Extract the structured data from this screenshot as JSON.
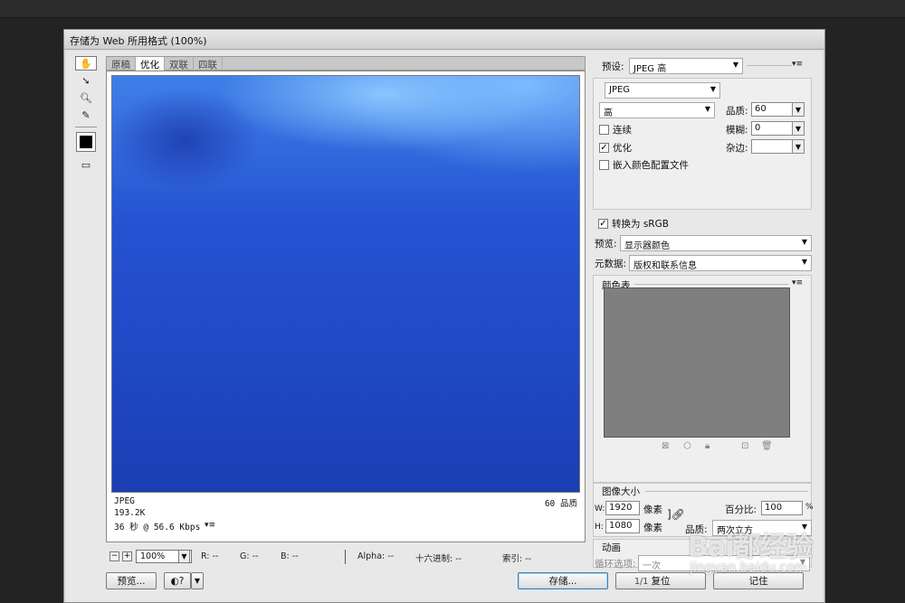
{
  "window": {
    "title": "存储为 Web 所用格式 (100%)"
  },
  "toolbox": {
    "tools": [
      "hand-tool",
      "slice-select-tool",
      "zoom-tool",
      "eyedropper-tool"
    ],
    "swatch_color": "#000000"
  },
  "tabs": [
    "原稿",
    "优化",
    "双联",
    "四联"
  ],
  "active_tab": "优化",
  "preview": {
    "format": "JPEG",
    "size": "193.2K",
    "time": "36 秒 @ 56.6 Kbps",
    "quality_label": "60 品质"
  },
  "status": {
    "zoom": "100%",
    "r": "R: --",
    "g": "G: --",
    "b": "B: --",
    "alpha": "Alpha: --",
    "hex": "十六进制: --",
    "index": "索引: --"
  },
  "buttons": {
    "preview": "预览...",
    "save": "存储...",
    "reset": "复位",
    "remember": "记住"
  },
  "settings": {
    "preset_label": "预设:",
    "preset_value": "JPEG 高",
    "format_value": "JPEG",
    "quality_preset": "高",
    "quality_label": "品质:",
    "quality_value": "60",
    "progressive_label": "连续",
    "blur_label": "模糊:",
    "blur_value": "0",
    "optimized_label": "优化",
    "matte_label": "杂边:",
    "embed_profile_label": "嵌入颜色配置文件",
    "convert_srgb_label": "转换为 sRGB",
    "preview_label": "预览:",
    "preview_value": "显示器颜色",
    "metadata_label": "元数据:",
    "metadata_value": "版权和联系信息"
  },
  "color_table": {
    "title": "颜色表",
    "fill": "#7f7f7f"
  },
  "image_size": {
    "title": "图像大小",
    "w_label": "W:",
    "w_value": "1920",
    "h_label": "H:",
    "h_value": "1080",
    "unit": "像素",
    "percent_label": "百分比:",
    "percent_value": "100",
    "percent_unit": "%",
    "quality_label": "品质:",
    "quality_value": "两次立方"
  },
  "animation": {
    "title": "动画",
    "loop_label": "循环选项:",
    "loop_value": "一次",
    "frame_counter": "1/1"
  },
  "watermark": {
    "brand": "Bai都经验",
    "url": "jingyan.baidu.com"
  }
}
